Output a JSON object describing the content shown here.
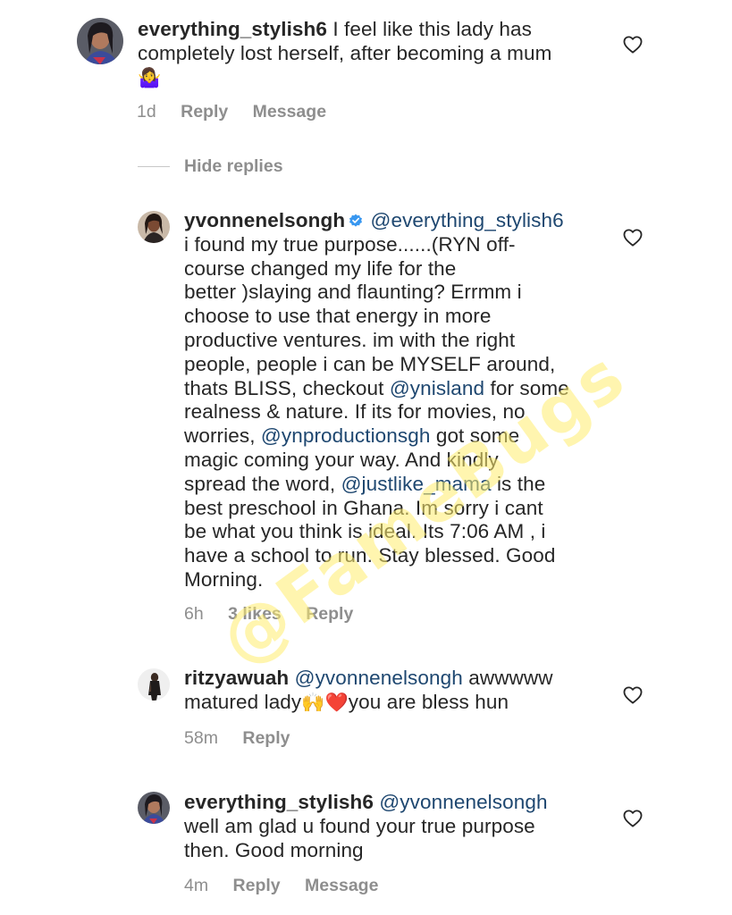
{
  "comments": [
    {
      "username": "everything_stylish6",
      "mention": "",
      "text_lines": [
        "I feel like this lady has",
        "completely lost herself, after becoming a mum"
      ],
      "emoji": "🤷‍♀️",
      "meta": {
        "time": "1d",
        "likes": "",
        "reply": "Reply",
        "message": "Message"
      }
    },
    {
      "username": "yvonnenelsongh",
      "verified": true,
      "mention": "@everything_stylish6",
      "line1": "i found my true purpose......(RYN off-",
      "line2": "course changed my life for the",
      "line3": "better )slaying and flaunting? Errmm i",
      "line4": "choose to use that energy in more",
      "line5": "productive ventures. im with the right",
      "line6": "people, people i can be MYSELF around,",
      "line7a": "thats BLISS, checkout ",
      "line7mention": "@ynisland",
      "line7b": " for some",
      "line8": "realness & nature. If its for movies, no",
      "line9a": "worries, ",
      "line9mention": "@ynproductionsgh",
      "line9b": " got some",
      "line10": "magic coming your way. And kindly",
      "line11a": "spread the word, ",
      "line11mention": "@justlike_mama",
      "line11b": " is the",
      "line12": "best preschool in Ghana. Im sorry i cant",
      "line13": "be what you think is ideal. Its 7:06 AM , i",
      "line14": "have a school to run. Stay blessed. Good",
      "line15": "Morning.",
      "meta": {
        "time": "6h",
        "likes": "3 likes",
        "reply": "Reply"
      }
    },
    {
      "username": "ritzyawuah",
      "mention": "@yvonnenelsongh",
      "text_a": " awwwww",
      "line2a": "matured lady",
      "emoji1": "🙌",
      "emoji2": "❤️",
      "line2b": "you are bless hun",
      "meta": {
        "time": "58m",
        "reply": "Reply"
      }
    },
    {
      "username": "everything_stylish6",
      "mention": "@yvonnenelsongh",
      "line2": "well am glad u found your true purpose",
      "line3": "then. Good morning",
      "meta": {
        "time": "4m",
        "reply": "Reply",
        "message": "Message"
      }
    }
  ],
  "hide_replies": "Hide replies",
  "watermark": "@FameBugs",
  "colors": {
    "text": "#262626",
    "mention": "#1e4770",
    "meta": "#8e8e8e",
    "verified": "#3897f0",
    "watermark": "#ffe86e"
  },
  "icons": [
    "heart-icon",
    "verified-badge-icon",
    "avatar"
  ]
}
